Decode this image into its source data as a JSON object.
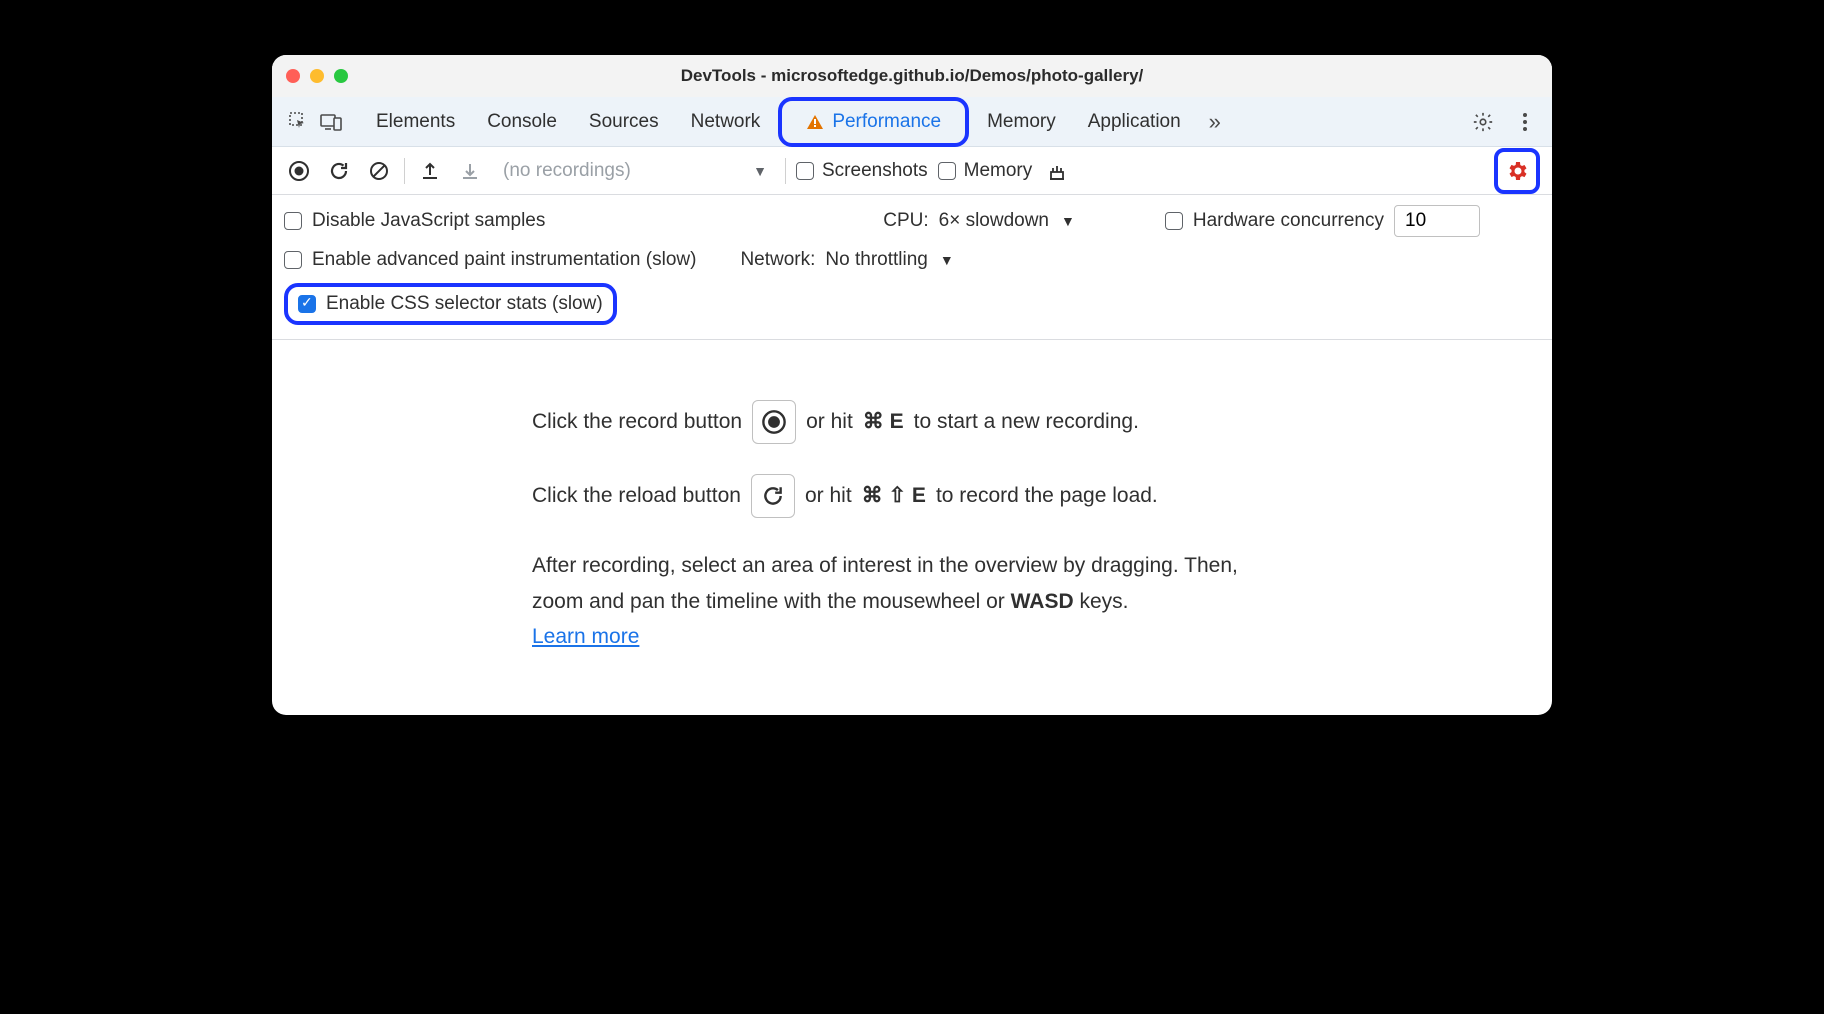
{
  "titlebar": {
    "title": "DevTools - microsoftedge.github.io/Demos/photo-gallery/"
  },
  "tabs": {
    "items": [
      "Elements",
      "Console",
      "Sources",
      "Network",
      "Performance",
      "Memory",
      "Application"
    ],
    "more": "»"
  },
  "toolbar": {
    "recordings_placeholder": "(no recordings)",
    "screenshots_label": "Screenshots",
    "memory_label": "Memory"
  },
  "settings": {
    "disable_js_label": "Disable JavaScript samples",
    "cpu_label": "CPU:",
    "cpu_value": "6× slowdown",
    "hw_label": "Hardware concurrency",
    "hw_value": "10",
    "paint_label": "Enable advanced paint instrumentation (slow)",
    "network_label": "Network:",
    "network_value": "No throttling",
    "css_label": "Enable CSS selector stats (slow)"
  },
  "instructions": {
    "line1a": "Click the record button",
    "line1b": "or hit",
    "line1_keys": "⌘ E",
    "line1c": "to start a new recording.",
    "line2a": "Click the reload button",
    "line2b": "or hit",
    "line2_keys": "⌘ ⇧ E",
    "line2c": "to record the page load.",
    "line3": "After recording, select an area of interest in the overview by dragging. Then, zoom and pan the timeline with the mousewheel or",
    "wasd": "WASD",
    "line3b": "keys.",
    "learn_more": "Learn more"
  }
}
